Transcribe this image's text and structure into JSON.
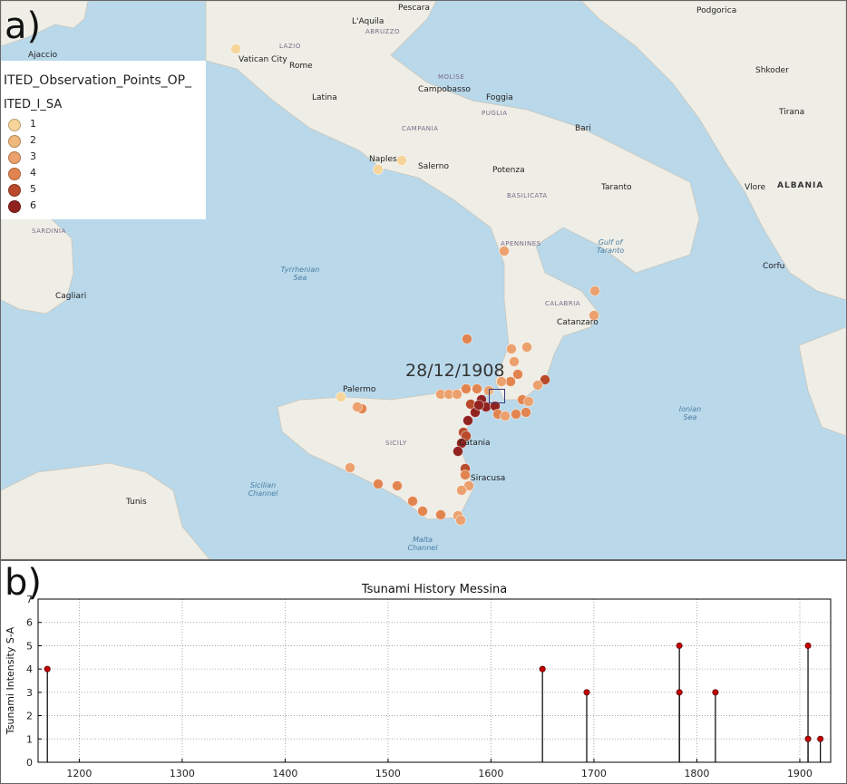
{
  "panel_a": {
    "label": "a)",
    "legend": {
      "title_line1": "ITED_Observation_Points_OP_",
      "title_line2": "ITED_I_SA",
      "items": [
        {
          "label": "1",
          "color": "#f6d49a"
        },
        {
          "label": "2",
          "color": "#efb87c"
        },
        {
          "label": "3",
          "color": "#eba06d"
        },
        {
          "label": "4",
          "color": "#e2844f"
        },
        {
          "label": "5",
          "color": "#b84a2b"
        },
        {
          "label": "6",
          "color": "#902320"
        }
      ]
    },
    "event_date": "28/12/1908",
    "map_labels": {
      "cities": [
        "Vatican City",
        "Rome",
        "Latina",
        "Naples",
        "Salerno",
        "Campobasso",
        "Foggia",
        "Bari",
        "Potenza",
        "Taranto",
        "Catanzaro",
        "Palermo",
        "Catania",
        "Siracusa",
        "Tunis",
        "Cagliari",
        "Tirana",
        "Pescara",
        "L'Aquila",
        "Podgorica",
        "Shkoder",
        "Ajaccio",
        "Vlore",
        "Corfu"
      ],
      "regions": [
        "LAZIO",
        "ABRUZZO",
        "MOLISE",
        "CAMPANIA",
        "PUGLIA",
        "BASILICATA",
        "CALABRIA",
        "SICILY",
        "SARDINIA",
        "APENNINES"
      ],
      "seas": [
        "Tyrrhenian Sea",
        "Gulf of Taranto",
        "Ionian Sea",
        "Sicilian Channel",
        "Malta Channel"
      ],
      "countries": [
        "ALBANIA"
      ]
    }
  },
  "panel_b": {
    "label": "b)"
  },
  "chart_data": {
    "type": "stem",
    "title": "Tsunami History Messina",
    "xlabel": "",
    "ylabel": "Tsunami Intensity S-A",
    "xlim": [
      1160,
      1930
    ],
    "ylim": [
      0,
      7
    ],
    "xticks": [
      1200,
      1300,
      1400,
      1500,
      1600,
      1700,
      1800,
      1900
    ],
    "yticks": [
      0,
      1,
      2,
      3,
      4,
      5,
      6,
      7
    ],
    "grid": true,
    "marker_color": "#c00000",
    "points": [
      {
        "x": 1169,
        "y": 4
      },
      {
        "x": 1650,
        "y": 4
      },
      {
        "x": 1693,
        "y": 3
      },
      {
        "x": 1783,
        "y": 5
      },
      {
        "x": 1783,
        "y": 3
      },
      {
        "x": 1818,
        "y": 3
      },
      {
        "x": 1908,
        "y": 5
      },
      {
        "x": 1908,
        "y": 1
      },
      {
        "x": 1920,
        "y": 1
      }
    ]
  }
}
